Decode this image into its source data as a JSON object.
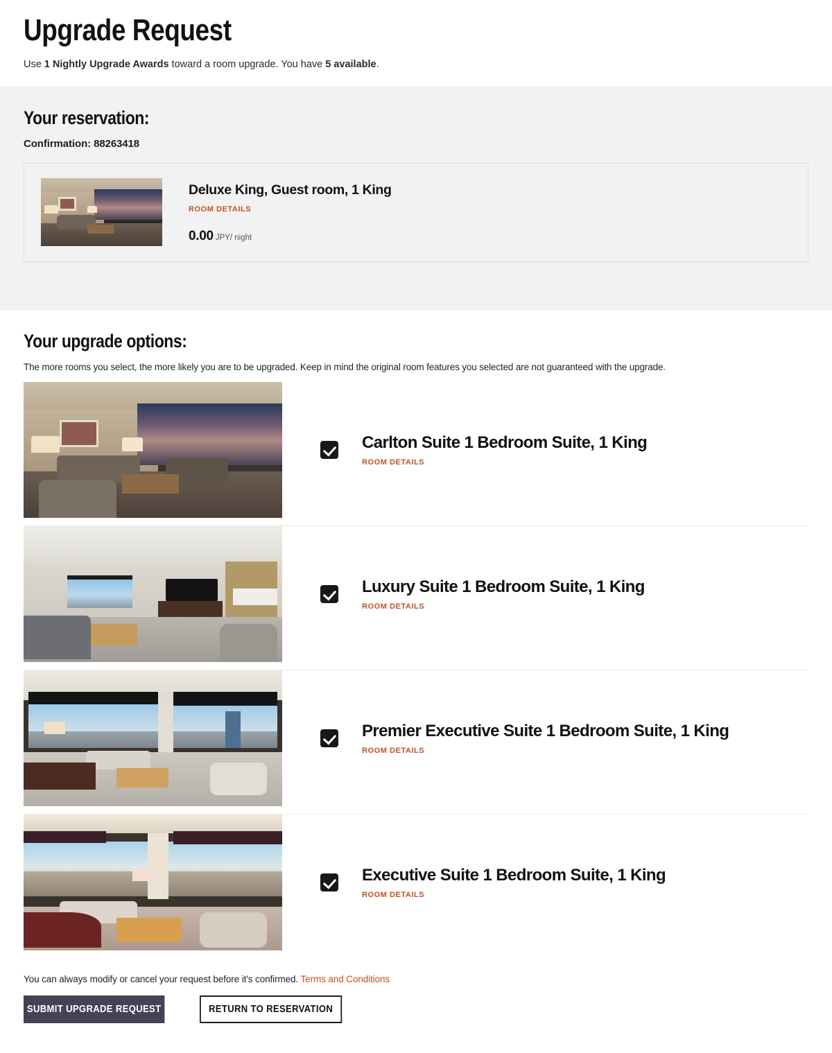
{
  "header": {
    "title": "Upgrade Request",
    "subtitle_prefix": "Use ",
    "subtitle_bold_1": "1 Nightly Upgrade Awards",
    "subtitle_middle": " toward a room upgrade. You have ",
    "subtitle_bold_2": "5 available",
    "subtitle_suffix": "."
  },
  "reservation": {
    "heading": "Your reservation:",
    "confirmation_label": "Confirmation: 88263418",
    "room_name": "Deluxe King, Guest room, 1 King",
    "room_details_label": "ROOM DETAILS",
    "price_amount": "0.00",
    "price_unit": "JPY/ night",
    "thumb_alt": "deluxe-king-room-photo"
  },
  "upgrade": {
    "heading": "Your upgrade options:",
    "note": "The more rooms you select, the more likely you are to be upgraded. Keep in mind the original room features you selected are not guaranteed with the upgrade.",
    "options": [
      {
        "title": "Carlton Suite 1 Bedroom Suite, 1 King",
        "room_details_label": "ROOM DETAILS",
        "checked": true,
        "thumb_alt": "carlton-suite-photo"
      },
      {
        "title": "Luxury Suite 1 Bedroom Suite, 1 King",
        "room_details_label": "ROOM DETAILS",
        "checked": true,
        "thumb_alt": "luxury-suite-photo"
      },
      {
        "title": "Premier Executive Suite 1 Bedroom Suite, 1 King",
        "room_details_label": "ROOM DETAILS",
        "checked": true,
        "thumb_alt": "premier-executive-suite-photo"
      },
      {
        "title": "Executive Suite 1 Bedroom Suite, 1 King",
        "room_details_label": "ROOM DETAILS",
        "checked": true,
        "thumb_alt": "executive-suite-photo"
      }
    ]
  },
  "footer": {
    "note": "You can always modify or cancel your request before it's confirmed.",
    "terms_label": "Terms and Conditions",
    "submit_label": "SUBMIT UPGRADE REQUEST",
    "return_label": "RETURN TO RESERVATION"
  },
  "colors": {
    "accent_orange": "#c2511f",
    "submit_button_bg": "#474155",
    "band_gray": "#f2f2f2",
    "checkbox_dark": "#181818"
  }
}
